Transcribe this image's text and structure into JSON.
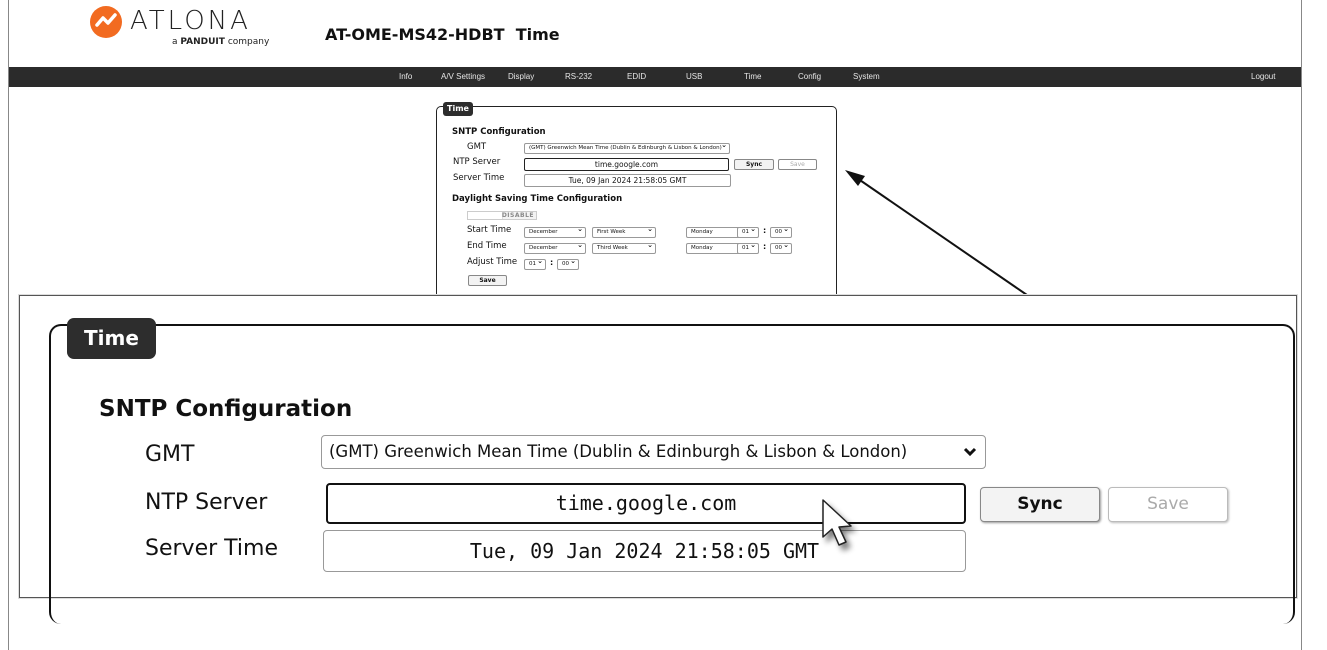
{
  "brand": {
    "name": "ATLONA",
    "tagline_brand": "PANDUIT",
    "tagline_rest": "company",
    "tagline_prefix": "a",
    "orange": "#f26b21"
  },
  "header": {
    "title": "AT-OME-MS42-HDBT  Time"
  },
  "nav": {
    "items": [
      "Info",
      "A/V Settings",
      "Display",
      "RS-232",
      "EDID",
      "USB",
      "Time",
      "Config",
      "System"
    ],
    "logout": "Logout"
  },
  "panel": {
    "tab": "Time",
    "sntp_heading": "SNTP Configuration",
    "gmt_label": "GMT",
    "gmt_value": "(GMT) Greenwich Mean Time (Dublin & Edinburgh & Lisbon & London)",
    "ntp_label": "NTP Server",
    "ntp_value": "time.google.com",
    "sync_label": "Sync",
    "save_label": "Save",
    "server_time_label": "Server Time",
    "server_time_value": "Tue, 09 Jan 2024 21:58:05 GMT",
    "dst_heading": "Daylight Saving Time Configuration",
    "dst_toggle": "DISABLE",
    "start_label": "Start Time",
    "end_label": "End Time",
    "adjust_label": "Adjust Time",
    "start": {
      "month": "December",
      "week": "First Week",
      "day": "Monday",
      "hour": "01",
      "minute": "00"
    },
    "end": {
      "month": "December",
      "week": "Third Week",
      "day": "Monday",
      "hour": "01",
      "minute": "00"
    },
    "adjust": {
      "hour": "01",
      "minute": "00"
    },
    "dst_save_label": "Save",
    "colon": ":"
  },
  "icons": {
    "chevron": "chevron-down-icon",
    "cursor": "mouse-pointer-icon",
    "arrow": "callout-arrow"
  }
}
